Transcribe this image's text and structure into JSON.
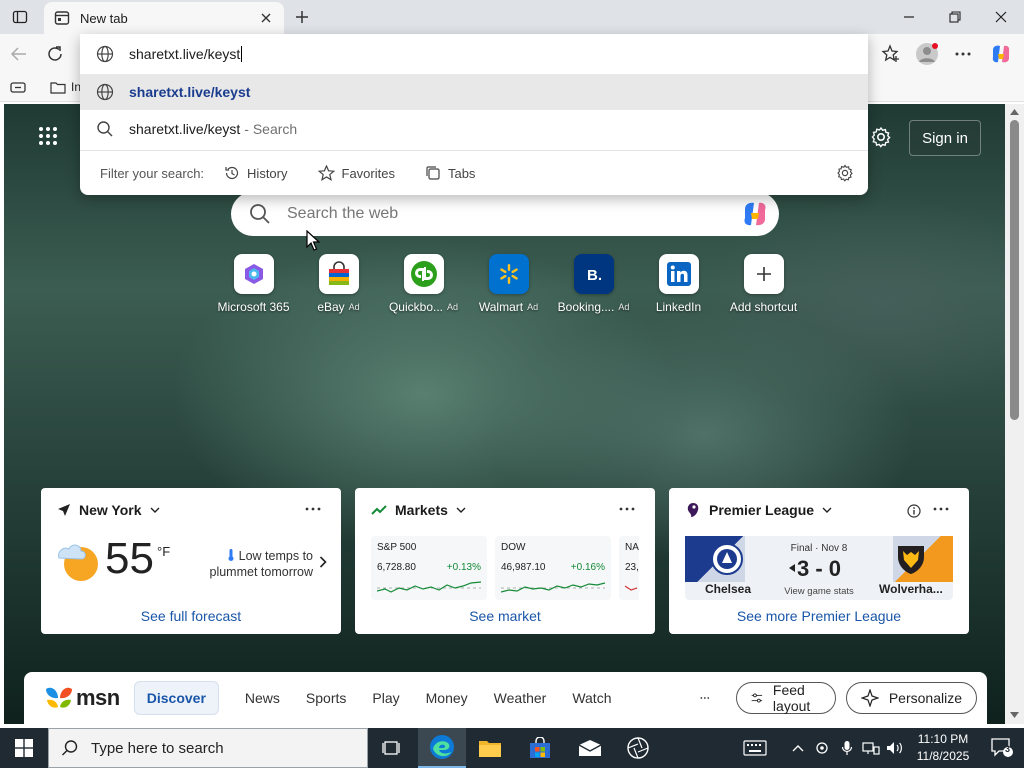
{
  "browser": {
    "tab_title": "New tab",
    "favbar_partial": "In"
  },
  "omnibox": {
    "value": "sharetxt.live/keyst",
    "suggestions": [
      {
        "text": "sharetxt.live/keyst",
        "icon": "globe-icon"
      },
      {
        "text": "sharetxt.live/keyst",
        "suffix": "- Search",
        "icon": "search-icon"
      }
    ],
    "filter_label": "Filter your search:",
    "filters": [
      "History",
      "Favorites",
      "Tabs"
    ]
  },
  "page": {
    "signin_label": "Sign in",
    "search_placeholder": "Search the web",
    "shortcuts": [
      {
        "name": "Microsoft 365",
        "ad": ""
      },
      {
        "name": "eBay",
        "ad": "Ad"
      },
      {
        "name": "Quickbo...",
        "ad": "Ad"
      },
      {
        "name": "Walmart",
        "ad": "Ad"
      },
      {
        "name": "Booking....",
        "ad": "Ad"
      },
      {
        "name": "LinkedIn",
        "ad": ""
      },
      {
        "name": "Add shortcut",
        "ad": ""
      }
    ]
  },
  "weather": {
    "location": "New York",
    "temp": "55",
    "unit": "°F",
    "note": "Low temps to plummet tomorrow",
    "link": "See full forecast"
  },
  "markets": {
    "title": "Markets",
    "tickers": [
      {
        "symbol": "S&P 500",
        "price": "6,728.80",
        "change": "+0.13%"
      },
      {
        "symbol": "DOW",
        "price": "46,987.10",
        "change": "+0.16%"
      },
      {
        "symbol": "NA",
        "price": "23,",
        "change": ""
      }
    ],
    "link": "See market"
  },
  "league": {
    "title": "Premier League",
    "home": "Chelsea",
    "away": "Wolverha...",
    "status": "Final · Nov 8",
    "score": "3 - 0",
    "stats": "View game stats",
    "link": "See more Premier League"
  },
  "msn": {
    "brand": "msn",
    "tabs": [
      "Discover",
      "News",
      "Sports",
      "Play",
      "Money",
      "Weather",
      "Watch"
    ],
    "feed_layout": "Feed layout",
    "personalize": "Personalize"
  },
  "taskbar": {
    "search_placeholder": "Type here to search",
    "time": "11:10 PM",
    "date": "11/8/2025",
    "notifications": "3"
  }
}
